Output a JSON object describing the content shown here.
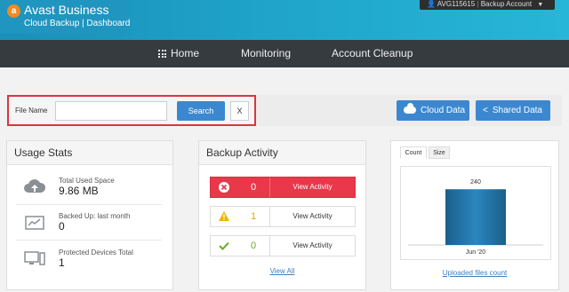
{
  "header": {
    "brand": "Avast Business",
    "subtitle": "Cloud Backup | Dashboard",
    "account_id": "AVG115615",
    "account_menu": "Backup Account"
  },
  "nav": {
    "items": [
      {
        "label": "Home",
        "icon": "grid-icon"
      },
      {
        "label": "Monitoring"
      },
      {
        "label": "Account Cleanup"
      }
    ]
  },
  "search": {
    "label": "File Name",
    "value": "",
    "placeholder": "",
    "search_button": "Search",
    "clear_button": "X"
  },
  "actions": {
    "cloud_data": "Cloud Data",
    "shared_data": "Shared Data"
  },
  "usage_stats": {
    "title": "Usage Stats",
    "items": [
      {
        "label": "Total Used Space",
        "value": "9.86 MB",
        "icon": "cloud-icon"
      },
      {
        "label": "Backed Up: last month",
        "value": "0",
        "icon": "chart-icon"
      },
      {
        "label": "Protected Devices Total",
        "value": "1",
        "icon": "devices-icon"
      }
    ]
  },
  "backup_activity": {
    "title": "Backup Activity",
    "rows": [
      {
        "status": "error",
        "icon": "error-icon",
        "count": "0",
        "link": "View Activity"
      },
      {
        "status": "warning",
        "icon": "warning-icon",
        "count": "1",
        "link": "View Activity"
      },
      {
        "status": "success",
        "icon": "check-icon",
        "count": "0",
        "link": "View Activity"
      }
    ],
    "view_all": "View All"
  },
  "uploads": {
    "tabs": [
      "Count",
      "Size"
    ],
    "active_tab": "Count",
    "link": "Uploaded files count"
  },
  "colors": {
    "header": "#1fa3c9",
    "nav": "#363b40",
    "primary": "#3c88d0",
    "danger": "#e8384a",
    "warning": "#f0b400",
    "success": "#6aaa2a",
    "bar": "#1e6fa0"
  },
  "chart_data": {
    "type": "bar",
    "categories": [
      "Jun '20"
    ],
    "values": [
      240
    ],
    "title": "",
    "xlabel": "",
    "ylabel": "",
    "ylim": [
      0,
      260
    ],
    "grid": false,
    "legend": "none"
  }
}
